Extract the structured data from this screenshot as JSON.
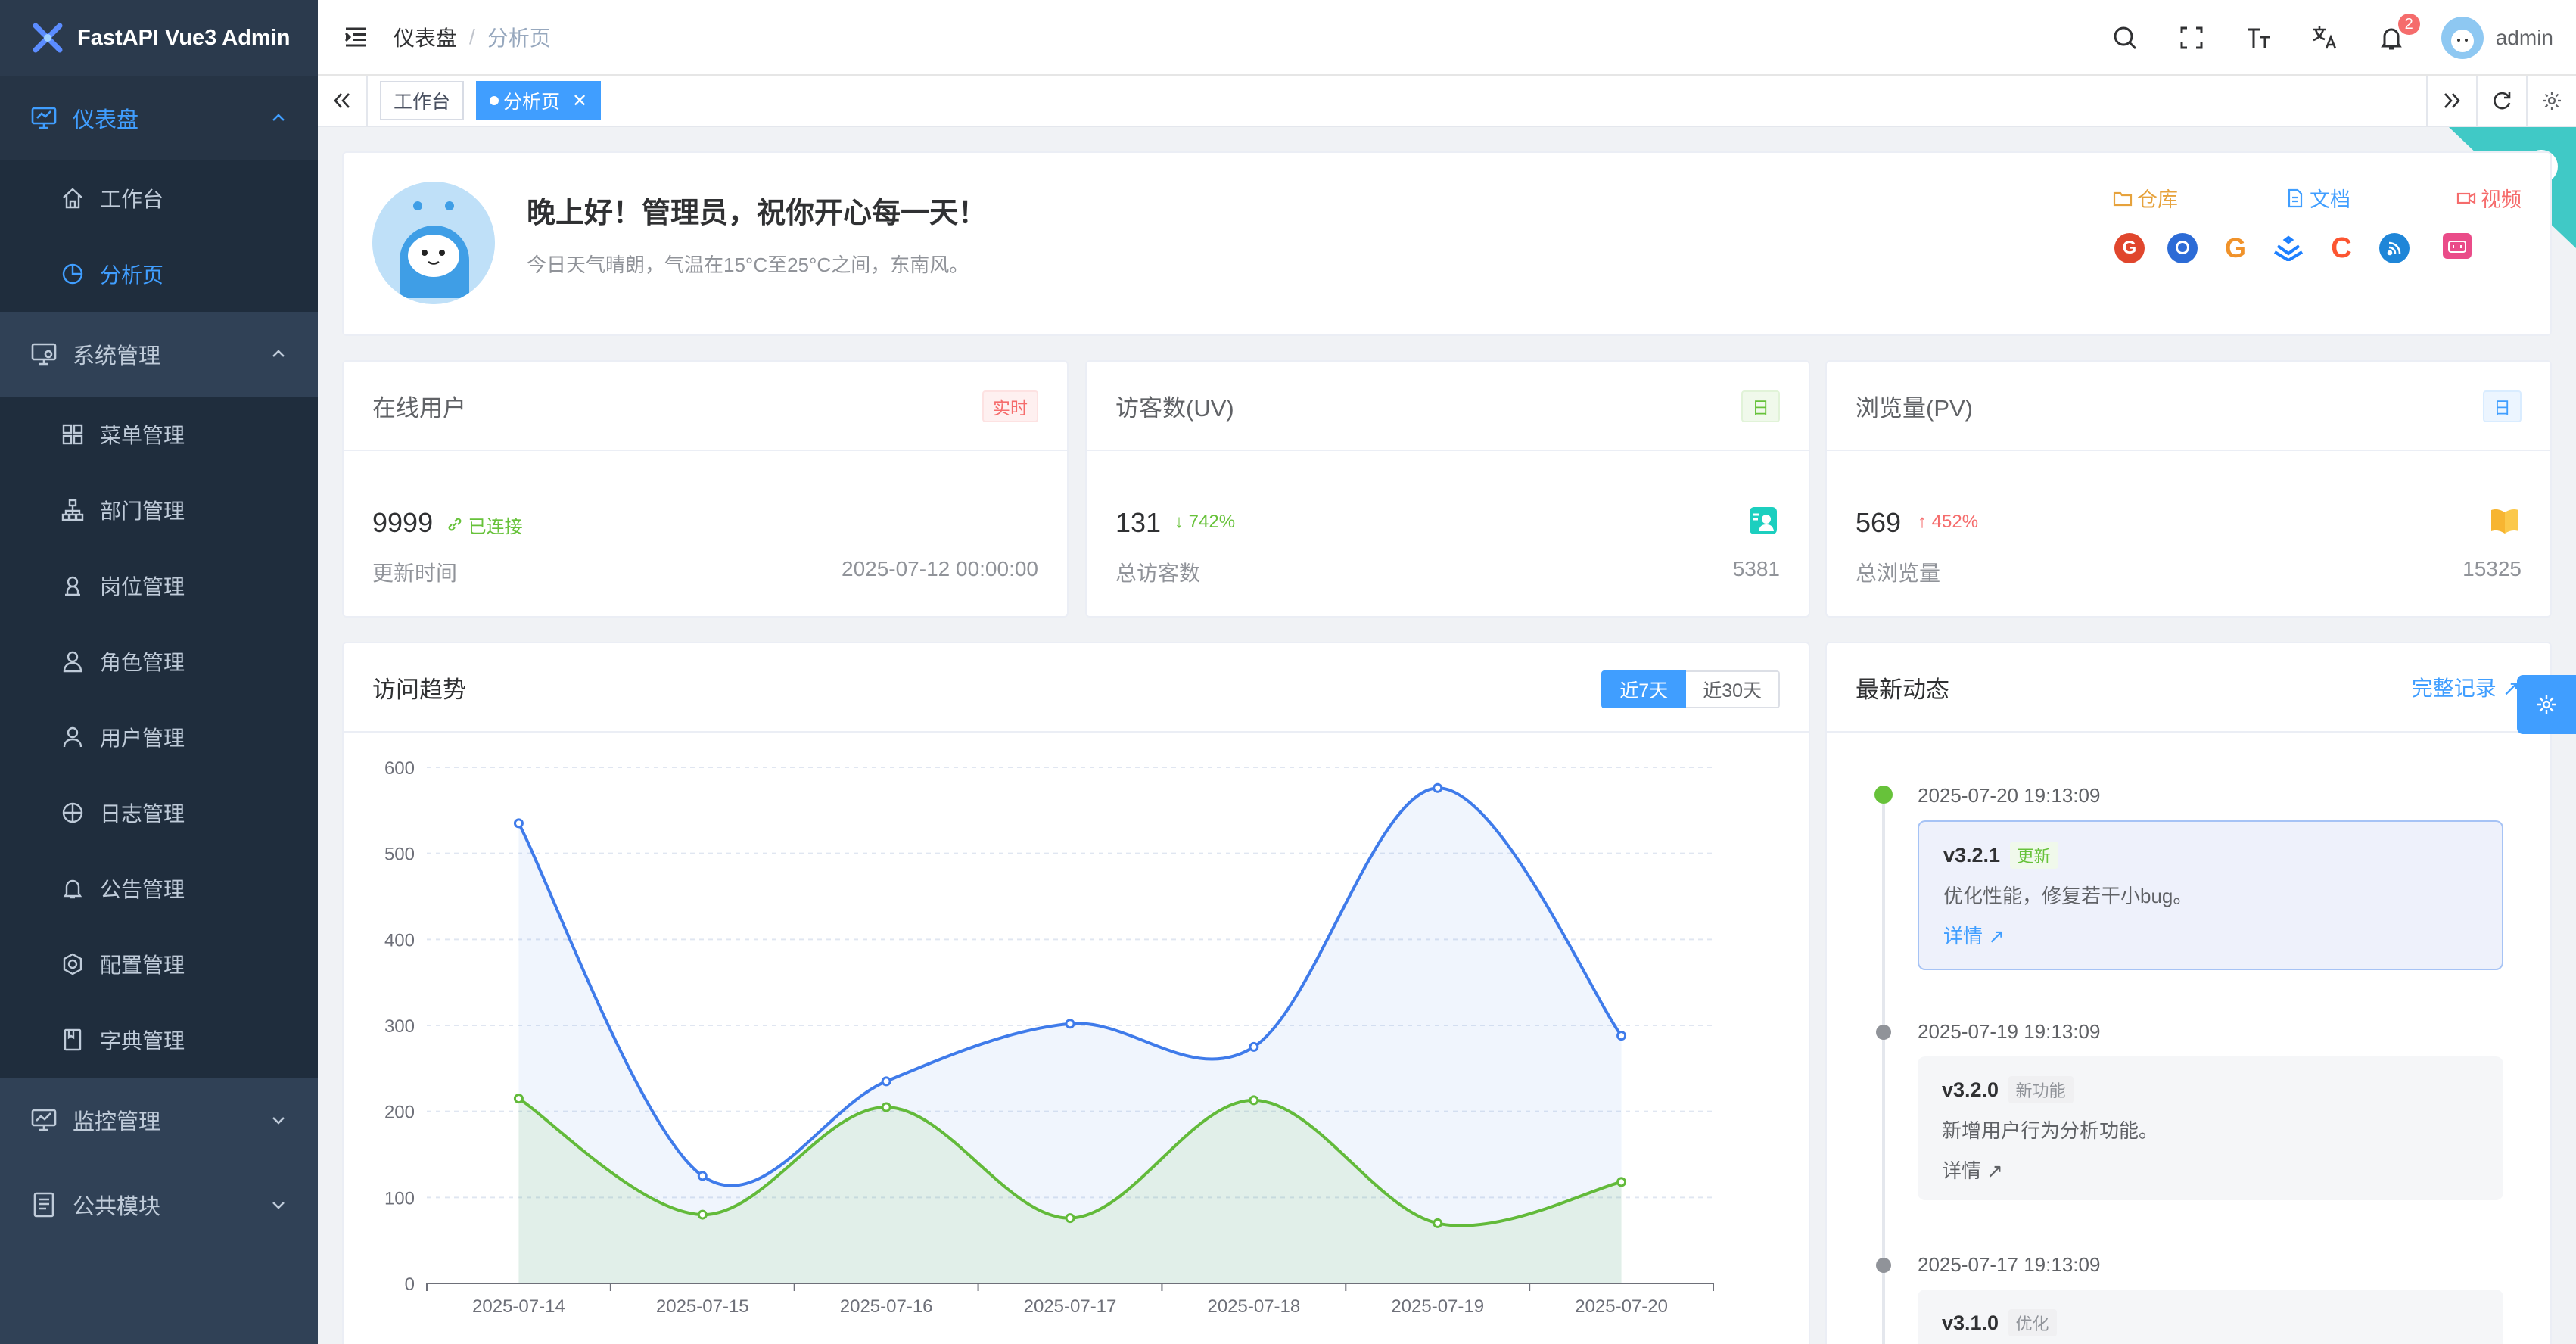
{
  "app": {
    "title": "FastAPI Vue3 Admin"
  },
  "sidebar": {
    "groups": [
      {
        "label": "仪表盘",
        "icon": "monitor-icon",
        "expanded": true,
        "items": [
          {
            "label": "工作台",
            "icon": "home-icon"
          },
          {
            "label": "分析页",
            "icon": "pie-chart-icon"
          }
        ]
      },
      {
        "label": "系统管理",
        "icon": "settings-monitor-icon",
        "expanded": true,
        "items": [
          {
            "label": "菜单管理",
            "icon": "grid-icon"
          },
          {
            "label": "部门管理",
            "icon": "org-tree-icon"
          },
          {
            "label": "岗位管理",
            "icon": "user-badge-icon"
          },
          {
            "label": "角色管理",
            "icon": "user-role-icon"
          },
          {
            "label": "用户管理",
            "icon": "user-icon"
          },
          {
            "label": "日志管理",
            "icon": "compass-icon"
          },
          {
            "label": "公告管理",
            "icon": "bell-icon"
          },
          {
            "label": "配置管理",
            "icon": "gear-icon"
          },
          {
            "label": "字典管理",
            "icon": "book-icon"
          }
        ]
      },
      {
        "label": "监控管理",
        "icon": "chart-monitor-icon",
        "expanded": false
      },
      {
        "label": "公共模块",
        "icon": "document-icon",
        "expanded": false
      }
    ]
  },
  "header": {
    "breadcrumb": [
      "仪表盘",
      "分析页"
    ],
    "notification_count": "2",
    "user_name": "admin"
  },
  "tags": [
    {
      "label": "工作台",
      "active": false
    },
    {
      "label": "分析页",
      "active": true
    }
  ],
  "welcome": {
    "title": "晚上好！管理员，祝你开心每一天！",
    "subtitle": "今日天气晴朗，气温在15°C至25°C之间，东南风。",
    "links": [
      {
        "label": "仓库",
        "color": "#e6a23c",
        "icon": "folder-icon"
      },
      {
        "label": "文档",
        "color": "#409eff",
        "icon": "document-icon"
      },
      {
        "label": "视频",
        "color": "#f56c6c",
        "icon": "video-icon"
      }
    ],
    "brand_icons": [
      "gitee-icon",
      "github-icon",
      "google-icon",
      "juejin-icon",
      "csdn-icon",
      "rss-icon",
      "bilibili-icon"
    ]
  },
  "stats": [
    {
      "title": "在线用户",
      "tag": "实时",
      "value": "9999",
      "delta": "已连接",
      "delta_color": "#67c23a",
      "foot_label": "更新时间",
      "foot_value": "2025-07-12 00:00:00"
    },
    {
      "title": "访客数(UV)",
      "tag": "日",
      "value": "131",
      "delta": "742%",
      "delta_color": "#67c23a",
      "foot_label": "总访客数",
      "foot_value": "5381"
    },
    {
      "title": "浏览量(PV)",
      "tag": "日",
      "value": "569",
      "delta": "452%",
      "delta_color": "#f56c6c",
      "foot_label": "总浏览量",
      "foot_value": "15325"
    }
  ],
  "trend": {
    "title": "访问趋势",
    "ranges": [
      "近7天",
      "近30天"
    ]
  },
  "chart_data": {
    "type": "area",
    "x": [
      "2025-07-14",
      "2025-07-15",
      "2025-07-16",
      "2025-07-17",
      "2025-07-18",
      "2025-07-19",
      "2025-07-20"
    ],
    "series": [
      {
        "color": "#3f7bea",
        "values": [
          535,
          125,
          235,
          302,
          275,
          576,
          288
        ]
      },
      {
        "color": "#62ba3a",
        "values": [
          215,
          80,
          205,
          76,
          213,
          70,
          118
        ]
      }
    ],
    "yticks": [
      0,
      100,
      200,
      300,
      400,
      500,
      600
    ],
    "ylim": [
      0,
      600
    ],
    "grid": true
  },
  "activity": {
    "title": "最新动态",
    "full_link": "完整记录",
    "items": [
      {
        "date": "2025-07-20 19:13:09",
        "version": "v3.2.1",
        "badge": "更新",
        "desc": "优化性能，修复若干小bug。",
        "more": "详情"
      },
      {
        "date": "2025-07-19 19:13:09",
        "version": "v3.2.0",
        "badge": "新功能",
        "desc": "新增用户行为分析功能。",
        "more": "详情"
      },
      {
        "date": "2025-07-17 19:13:09",
        "version": "v3.1.0",
        "badge": "优化",
        "desc": "",
        "more": ""
      }
    ]
  }
}
